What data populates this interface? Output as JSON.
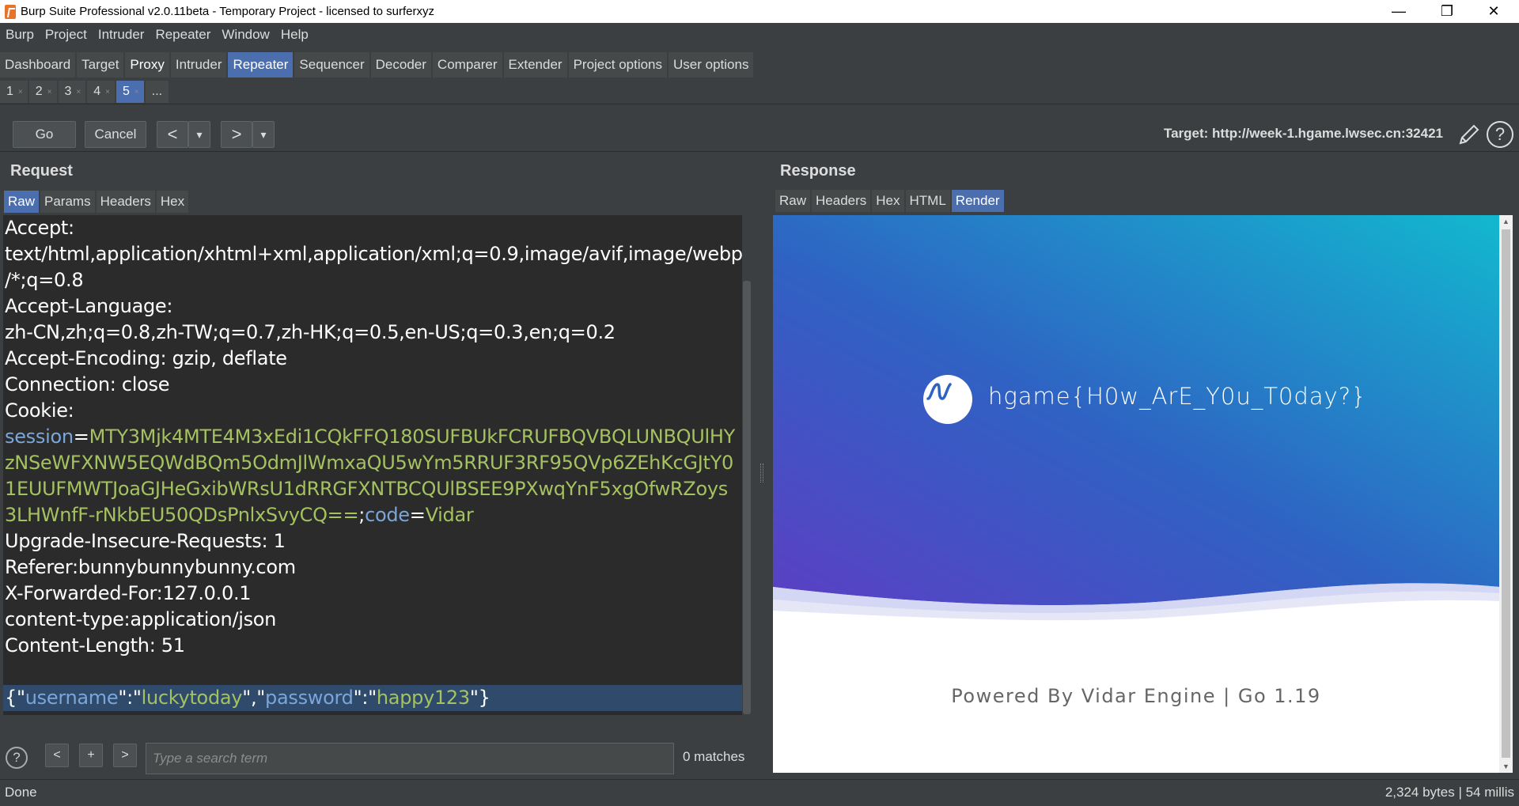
{
  "window": {
    "title": "Burp Suite Professional v2.0.11beta - Temporary Project - licensed to surferxyz",
    "minimize": "—",
    "restore": "❐",
    "close": "✕"
  },
  "menu": [
    "Burp",
    "Project",
    "Intruder",
    "Repeater",
    "Window",
    "Help"
  ],
  "main_tabs": [
    "Dashboard",
    "Target",
    "Proxy",
    "Intruder",
    "Repeater",
    "Sequencer",
    "Decoder",
    "Comparer",
    "Extender",
    "Project options",
    "User options"
  ],
  "active_main_tab": "Repeater",
  "sub_tabs": [
    "1",
    "2",
    "3",
    "4",
    "5"
  ],
  "sub_tab_close": "×",
  "sub_tab_more": "...",
  "toolbar": {
    "go": "Go",
    "cancel": "Cancel",
    "back": "<",
    "back_menu": "▾",
    "forward": ">",
    "forward_menu": "▾",
    "target_label": "Target: http://week-1.hgame.lwsec.cn:32421",
    "help": "?"
  },
  "request": {
    "title": "Request",
    "tabs": [
      "Raw",
      "Params",
      "Headers",
      "Hex"
    ],
    "active_tab": "Raw",
    "lines": {
      "l1": "Accept:",
      "l2": "text/html,application/xhtml+xml,application/xml;q=0.9,image/avif,image/webp,*",
      "l3": "/*;q=0.8",
      "l4": "Accept-Language:",
      "l5": "zh-CN,zh;q=0.8,zh-TW;q=0.7,zh-HK;q=0.5,en-US;q=0.3,en;q=0.2",
      "l6": "Accept-Encoding: gzip, deflate",
      "l7": "Connection: close",
      "l8": "Cookie:",
      "cookie_key": "session",
      "eq": "=",
      "cookie_val_1": "MTY3Mjk4MTE4M3xEdi1CQkFFQ180SUFBUkFCRUFBQVBQLUNBQUlHY",
      "cookie_val_2": "zNSeWFXNW5EQWdBQm5OdmJlWmxaQU5wYm5RRUF3RF95QVp6ZEhKcGJtY0",
      "cookie_val_3": "1EUUFMWTJoaGJHeGxibWRsU1dRRGFXNTBCQUlBSEE9PXwqYnF5xgOfwRZoys",
      "cookie_val_4": "3LHWnfF-rNkbEU50QDsPnlxSvyCQ==",
      "semi": ";",
      "code_key": "code",
      "code_val": "Vidar",
      "l13": "Upgrade-Insecure-Requests: 1",
      "l14": "Referer:bunnybunnybunny.com",
      "l15": "X-Forwarded-For:127.0.0.1",
      "l16": "content-type:application/json",
      "l17": "Content-Length: 51",
      "body_open": "{",
      "body_q": "\"",
      "body_user_key": "username",
      "body_colon": ":",
      "body_user_val": "luckytoday",
      "body_comma": ",",
      "body_pass_key": "password",
      "body_pass_val": "happy123",
      "body_close": "}"
    }
  },
  "search": {
    "help": "?",
    "prev": "<",
    "add": "+",
    "next": ">",
    "placeholder": "Type a search term",
    "matches": "0 matches"
  },
  "response": {
    "title": "Response",
    "tabs": [
      "Raw",
      "Headers",
      "Hex",
      "HTML",
      "Render"
    ],
    "active_tab": "Render",
    "flag": "hgame{H0w_ArE_Y0u_T0day?}",
    "powered": "Powered By Vidar Engine | Go 1.19",
    "gradient_start": "#5b3fc4",
    "gradient_end": "#12b8cf"
  },
  "status": {
    "left": "Done",
    "right": "2,324 bytes | 54 millis"
  }
}
